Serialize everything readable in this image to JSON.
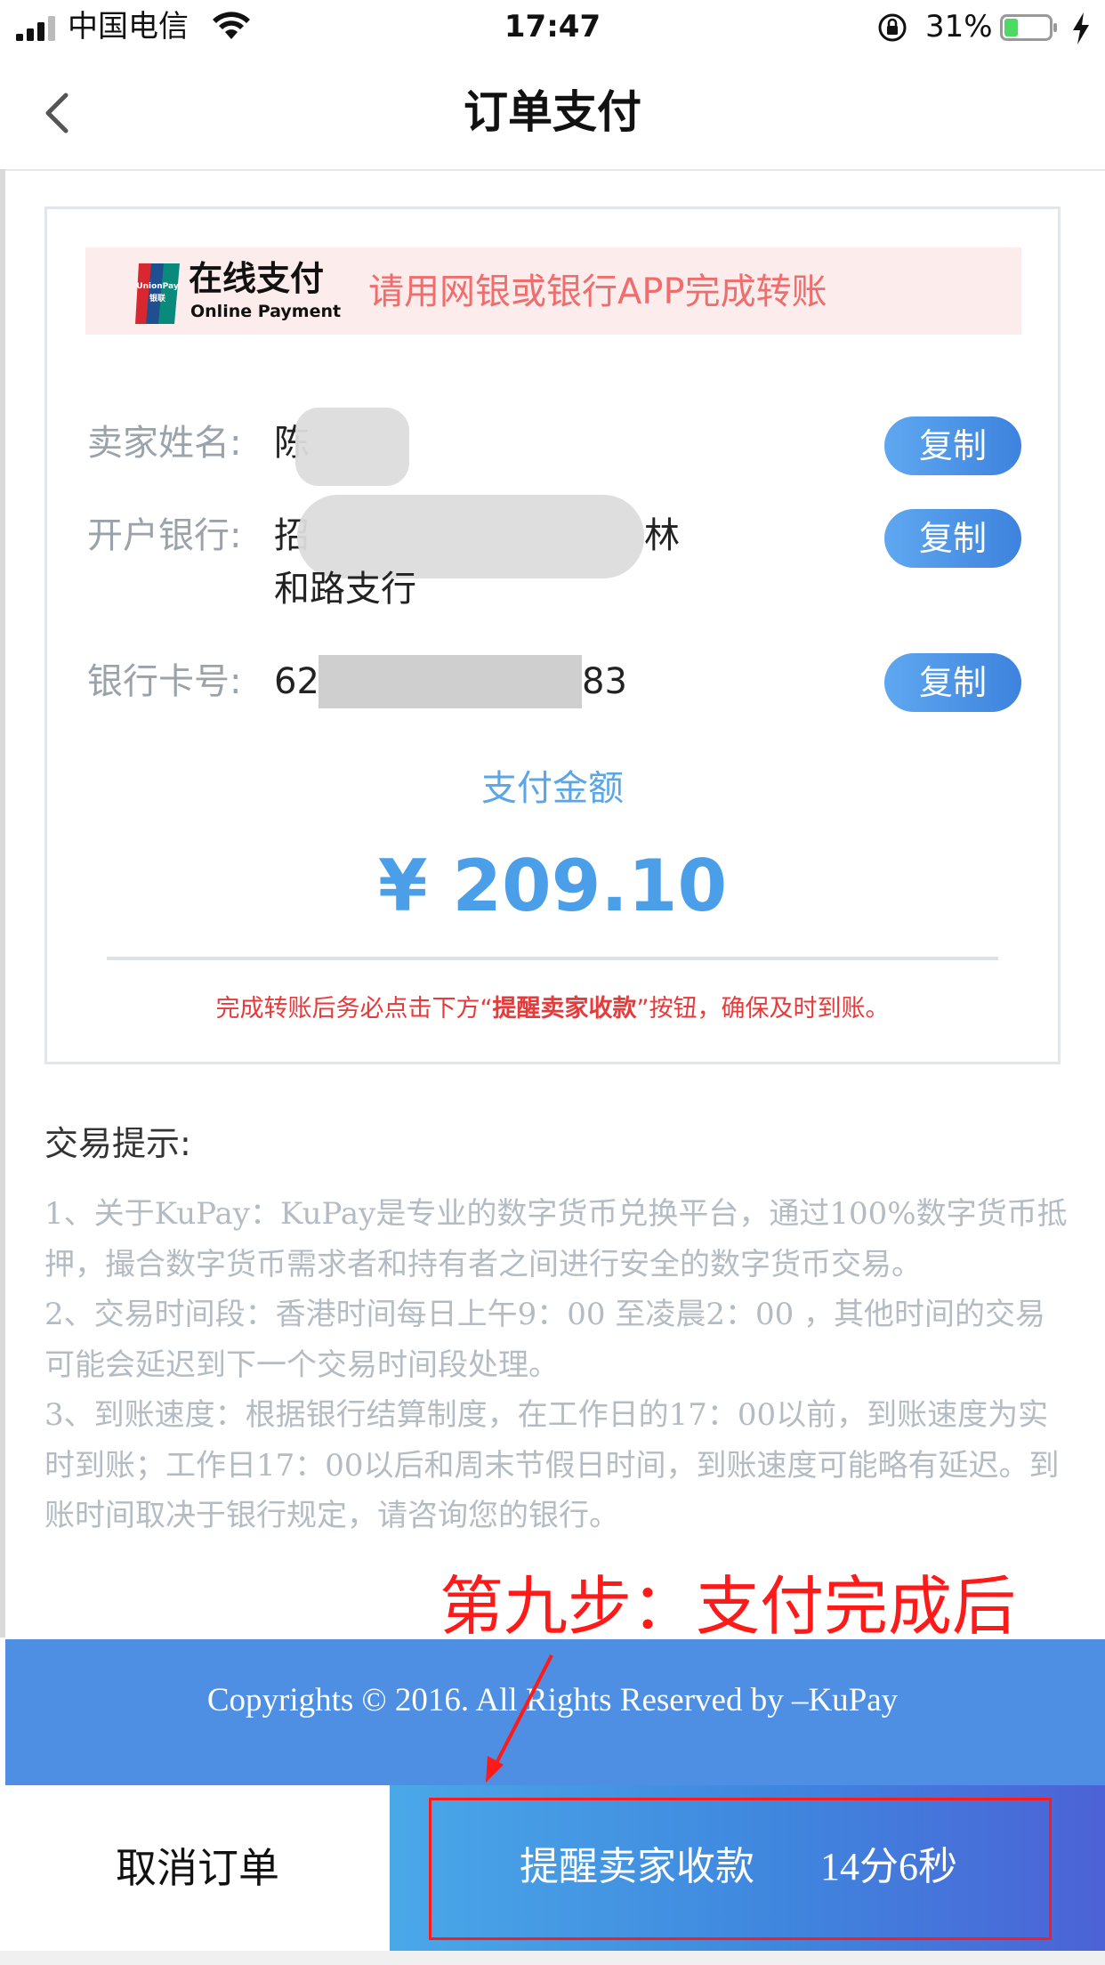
{
  "status_bar": {
    "carrier": "中国电信",
    "time": "17:47",
    "battery_percent": "31%",
    "battery_level": 0.31
  },
  "nav": {
    "title": "订单支付"
  },
  "banner": {
    "brand_cn": "在线支付",
    "brand_en": "Online Payment",
    "instruction": "请用网银或银行APP完成转账"
  },
  "seller": {
    "name_label": "卖家姓名:",
    "name_value": "陈",
    "bank_label": "开户银行:",
    "bank_value_prefix": "招",
    "bank_value_suffix": "林",
    "bank_value_line2": "和路支行",
    "card_label": "银行卡号:",
    "card_value_prefix": "62",
    "card_value_suffix": "83",
    "copy_label": "复制"
  },
  "payment": {
    "amount_label": "支付金额",
    "amount_value": "¥ 209.10",
    "notice_before": "完成转账后务必点击下方“",
    "notice_bold": "提醒卖家收款",
    "notice_after": "”按钮，确保及时到账。"
  },
  "tips": {
    "title": "交易提示:",
    "items": [
      "1、关于KuPay：KuPay是专业的数字货币兑换平台，通过100%数字货币抵押，撮合数字货币需求者和持有者之间进行安全的数字货币交易。",
      "2、交易时间段：香港时间每日上午9：00 至凌晨2：00 ，其他时间的交易可能会延迟到下一个交易时间段处理。",
      "3、到账速度：根据银行结算制度，在工作日的17：00以前，到账速度为实时到账；工作日17：00以后和周末节假日时间，到账速度可能略有延迟。到账时间取决于银行规定，请咨询您的银行。"
    ]
  },
  "footer": {
    "copyright": "Copyrights © 2016. All Rights Reserved by –KuPay"
  },
  "actions": {
    "cancel_label": "取消订单",
    "remind_label": "提醒卖家收款",
    "remind_timer": "14分6秒"
  },
  "annotation": {
    "text": "第九步：支付完成后"
  },
  "colors": {
    "accent_blue": "#4a9fe8",
    "notice_red": "#e83a3a",
    "annotation_red": "#ff1a1a"
  }
}
